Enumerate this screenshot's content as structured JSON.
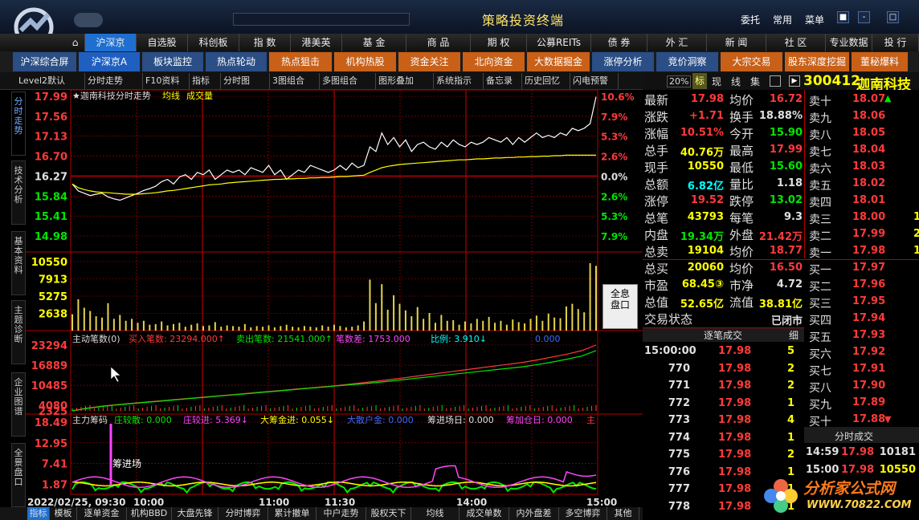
{
  "app_title": "策略投资终端",
  "colors": {
    "up": "#ff3a3a",
    "down": "#00e600",
    "neutral": "#e0e0e0",
    "yellow": "#ffff00",
    "cyan": "#00ffff",
    "grid": "#b00000",
    "accent": "#1e6fd0"
  },
  "titlebar_right": [
    "委托",
    "常用",
    "菜单"
  ],
  "nav_main": [
    "沪深京",
    "自选股",
    "科创板",
    "指 数",
    "港美英",
    "基 金",
    "商 品",
    "期 权",
    "公募REITs",
    "债 券",
    "外 汇",
    "新 闻",
    "社 区",
    "专业数据",
    "投 行"
  ],
  "nav_sub": [
    {
      "label": "沪深综合屏",
      "bg": "#2a4e85"
    },
    {
      "label": "沪深京A",
      "bg": "#1f5fc0"
    },
    {
      "label": "板块监控",
      "bg": "#2a4e85"
    },
    {
      "label": "热点轮动",
      "bg": "#2a4e85"
    },
    {
      "label": "热点狙击",
      "bg": "#c86018"
    },
    {
      "label": "机构热股",
      "bg": "#c86018"
    },
    {
      "label": "资金关注",
      "bg": "#c86018"
    },
    {
      "label": "北向资金",
      "bg": "#c86018"
    },
    {
      "label": "大数据掘金",
      "bg": "#c86018"
    },
    {
      "label": "涨停分析",
      "bg": "#2a4e85"
    },
    {
      "label": "竞价洞察",
      "bg": "#2a4e85"
    },
    {
      "label": "大宗交易",
      "bg": "#c86018"
    },
    {
      "label": "股东深度挖掘",
      "bg": "#c86018"
    },
    {
      "label": "董秘爆料",
      "bg": "#c86018"
    }
  ],
  "toolbar": [
    "Level2默认",
    "分时走势",
    "F10资料",
    "指标",
    "分时图",
    "3图组合",
    "多图组合",
    "图形叠加",
    "系统指示",
    "备忘录",
    "历史回忆",
    "闪电预警"
  ],
  "left_tabs": [
    "分时走势",
    "技术分析",
    "基本资料",
    "主题诊断",
    "企业图谱",
    "全景盘口"
  ],
  "chart_data": [
    {
      "type": "line",
      "title": "★迦南科技分时走势",
      "legend": [
        "均线",
        "成交量"
      ],
      "y_left": [
        "17.99",
        "17.56",
        "17.13",
        "16.70",
        "16.27",
        "15.84",
        "15.41",
        "14.98"
      ],
      "y_right": [
        "10.6%",
        "7.9%",
        "5.3%",
        "2.6%",
        "0.0%",
        "2.6%",
        "5.3%",
        "7.9%"
      ],
      "ylim": [
        14.98,
        17.99
      ],
      "preclose": 16.27,
      "series": [
        {
          "name": "价格",
          "values": [
            16.1,
            15.95,
            15.9,
            15.85,
            15.88,
            15.9,
            15.82,
            15.78,
            15.75,
            15.8,
            15.85,
            15.9,
            15.96,
            16.0,
            16.05,
            16.15,
            16.2,
            16.1,
            16.25,
            16.3,
            16.2,
            16.35,
            16.3,
            16.4,
            16.2,
            16.3,
            16.4,
            16.35,
            16.4,
            16.3,
            16.45,
            16.4,
            16.35,
            16.5,
            16.3,
            16.4,
            16.2,
            16.3,
            16.4,
            16.35,
            16.5,
            16.45,
            16.4,
            16.35,
            16.4,
            16.5,
            16.4,
            16.55,
            16.45,
            16.5,
            16.9,
            16.8,
            17.2,
            16.95,
            17.1,
            16.9,
            17.05,
            16.8,
            16.95,
            17.0,
            16.9,
            16.85,
            17.0,
            16.9,
            17.05,
            16.95,
            16.9,
            17.0,
            16.95,
            17.0,
            17.1,
            17.05,
            17.0,
            17.1,
            16.95,
            17.1,
            17.0,
            17.1,
            17.2,
            17.1,
            17.15,
            17.1,
            17.2,
            17.15,
            17.3,
            17.25,
            17.3,
            17.4,
            17.98
          ]
        },
        {
          "name": "均线",
          "values": [
            16.1,
            16.02,
            15.98,
            15.95,
            15.93,
            15.92,
            15.91,
            15.9,
            15.89,
            15.88,
            15.88,
            15.88,
            15.89,
            15.9,
            15.91,
            15.93,
            15.95,
            15.96,
            15.98,
            16.0,
            16.02,
            16.04,
            16.06,
            16.08,
            16.09,
            16.1,
            16.12,
            16.13,
            16.14,
            16.15,
            16.16,
            16.17,
            16.18,
            16.19,
            16.2,
            16.2,
            16.21,
            16.21,
            16.22,
            16.22,
            16.23,
            16.23,
            16.24,
            16.24,
            16.25,
            16.26,
            16.26,
            16.27,
            16.28,
            16.29,
            16.35,
            16.4,
            16.45,
            16.48,
            16.5,
            16.52,
            16.53,
            16.54,
            16.55,
            16.56,
            16.57,
            16.58,
            16.59,
            16.6,
            16.61,
            16.62,
            16.62,
            16.63,
            16.64,
            16.64,
            16.65,
            16.66,
            16.66,
            16.67,
            16.67,
            16.68,
            16.68,
            16.69,
            16.69,
            16.7,
            16.7,
            16.71,
            16.71,
            16.72,
            16.72,
            16.72,
            16.72,
            16.72,
            16.72
          ]
        }
      ]
    },
    {
      "type": "bar",
      "title": "成交量",
      "y_labels": [
        "10550",
        "7913",
        "5275",
        "2638"
      ],
      "ylim": [
        0,
        10550
      ],
      "values": [
        2500,
        4800,
        3500,
        3000,
        2200,
        2000,
        4200,
        1800,
        2400,
        1500,
        1800,
        1200,
        1500,
        900,
        1000,
        1400,
        800,
        1000,
        1200,
        600,
        900,
        1100,
        700,
        800,
        1300,
        600,
        800,
        700,
        600,
        1000,
        500,
        700,
        600,
        800,
        500,
        700,
        900,
        600,
        500,
        700,
        600,
        500,
        800,
        600,
        900,
        700,
        500,
        600,
        800,
        1400,
        7800,
        4200,
        7100,
        3200,
        5400,
        4100,
        3100,
        2200,
        3600,
        1800,
        2700,
        1200,
        2400,
        1500,
        1600,
        900,
        1400,
        1100,
        1800,
        1500,
        2100,
        1200,
        1500,
        900,
        1700,
        1300,
        1100,
        1800,
        2300,
        1500,
        2600,
        2000,
        1900,
        3700,
        4100,
        3300,
        2800,
        10300,
        9900
      ]
    },
    {
      "type": "line",
      "title": "主动笔数(0)",
      "legend": [
        "买入笔数: 23294.000↑",
        "卖出笔数: 21541.000↑",
        "笔数差: 1753.000",
        "比例: 3.910↓",
        "0.000"
      ],
      "y_labels": [
        "23294",
        "16889",
        "10485",
        "4080",
        "2325"
      ],
      "ylim": [
        2325,
        23294
      ],
      "series": [
        {
          "name": "买入笔数",
          "values": [
            2325,
            3200,
            3800,
            4300,
            4700,
            5100,
            5500,
            5900,
            6300,
            6700,
            7100,
            7500,
            7900,
            8300,
            8700,
            9100,
            9500,
            9900,
            10300,
            10800,
            11300,
            11800,
            12400,
            13000,
            13600,
            14200,
            14800,
            15400,
            16000,
            16600,
            17200,
            17800,
            18600,
            19500,
            20400,
            21500,
            23294
          ]
        },
        {
          "name": "卖出笔数",
          "values": [
            2325,
            3100,
            3700,
            4200,
            4600,
            5000,
            5400,
            5800,
            6200,
            6600,
            7000,
            7400,
            7800,
            8200,
            8600,
            9000,
            9400,
            9800,
            10200,
            10600,
            11000,
            11400,
            11900,
            12400,
            12900,
            13400,
            13900,
            14400,
            14900,
            15400,
            15900,
            16400,
            17100,
            17900,
            18800,
            19800,
            21541
          ]
        }
      ]
    },
    {
      "type": "line",
      "title": "主力筹码",
      "legend": [
        "庄较散: 0.000",
        "庄较进: 5.369↓",
        "大筹金进: 0.055↓",
        "大散户金: 0.000",
        "筹进场日: 0.000",
        "筹加仓日: 0.000",
        "主"
      ],
      "annotation": "筹进场",
      "y_labels": [
        "18.49",
        "12.95",
        "7.41",
        "1.87"
      ],
      "ylim": [
        0,
        18.49
      ]
    }
  ],
  "time_axis": [
    "2022/02/25, 09:30",
    "10:00",
    "11:00",
    "11:30",
    "14:00",
    "15:00"
  ],
  "bottom_tabs": [
    "指标",
    "模板",
    "逐单资金",
    "机构BBD",
    "大盘先锋",
    "分时博弈",
    "累计撤单",
    "中户走势",
    "股权天下",
    "均线",
    "成交单数",
    "内外盘差",
    "多空博弈",
    "其他"
  ],
  "stock": {
    "code": "300412",
    "name": "迦南科技",
    "zoom": "20%",
    "tabs": [
      "标",
      "现",
      "线",
      "集"
    ]
  },
  "quotes": [
    [
      "最新",
      "17.98",
      "均价",
      "16.72"
    ],
    [
      "涨跌",
      "+1.71",
      "换手",
      "18.88%"
    ],
    [
      "涨幅",
      "10.51%",
      "今开",
      "15.90"
    ],
    [
      "总手",
      "40.76万",
      "最高",
      "17.99"
    ],
    [
      "现手",
      "10550",
      "最低",
      "15.60"
    ],
    [
      "总额",
      "6.82亿",
      "量比",
      "1.18"
    ],
    [
      "涨停",
      "19.52",
      "跌停",
      "13.02"
    ],
    [
      "总笔",
      "43793",
      "每笔",
      "9.3"
    ],
    [
      "内盘",
      "19.34万",
      "外盘",
      "21.42万"
    ],
    [
      "总卖",
      "19104",
      "均价",
      "18.77"
    ],
    [
      "总买",
      "20060",
      "均价",
      "16.50"
    ],
    [
      "市盈",
      "68.45③",
      "市净",
      "4.72"
    ],
    [
      "总值",
      "52.65亿",
      "流值",
      "38.81亿"
    ],
    [
      "交易状态",
      "",
      "",
      "已闭市"
    ]
  ],
  "asks": [
    [
      "卖十",
      "18.07"
    ],
    [
      "卖九",
      "18.06"
    ],
    [
      "卖八",
      "18.05"
    ],
    [
      "卖七",
      "18.04"
    ],
    [
      "卖六",
      "18.03"
    ],
    [
      "卖五",
      "18.02"
    ],
    [
      "卖四",
      "18.01"
    ],
    [
      "卖三",
      "18.00",
      "1"
    ],
    [
      "卖二",
      "17.99",
      "2"
    ],
    [
      "卖一",
      "17.98",
      "1"
    ]
  ],
  "bids": [
    [
      "买一",
      "17.97"
    ],
    [
      "买二",
      "17.96"
    ],
    [
      "买三",
      "17.95"
    ],
    [
      "买四",
      "17.94"
    ],
    [
      "买五",
      "17.93"
    ],
    [
      "买六",
      "17.92"
    ],
    [
      "买七",
      "17.91"
    ],
    [
      "买八",
      "17.90"
    ],
    [
      "买九",
      "17.89"
    ],
    [
      "买十",
      "17.88"
    ]
  ],
  "ticks_title": "逐笔成交",
  "ticks_detail": "细",
  "ticks": [
    [
      "15:00:00",
      "17.98",
      "5"
    ],
    [
      "770",
      "17.98",
      "2"
    ],
    [
      "771",
      "17.98",
      "2"
    ],
    [
      "772",
      "17.98",
      "1"
    ],
    [
      "773",
      "17.98",
      "4"
    ],
    [
      "774",
      "17.98",
      "1"
    ],
    [
      "775",
      "17.98",
      "2"
    ],
    [
      "776",
      "17.98",
      "1"
    ],
    [
      "777",
      "17.98",
      "1"
    ],
    [
      "778",
      "17.98",
      "1"
    ]
  ],
  "minute_title": "分时成交",
  "minute": [
    [
      "14:59",
      "17.98",
      "10181"
    ],
    [
      "15:00",
      "17.98",
      "10550"
    ]
  ],
  "brand": {
    "name": "分析家公式网",
    "url": "WWW.70822.COM"
  }
}
